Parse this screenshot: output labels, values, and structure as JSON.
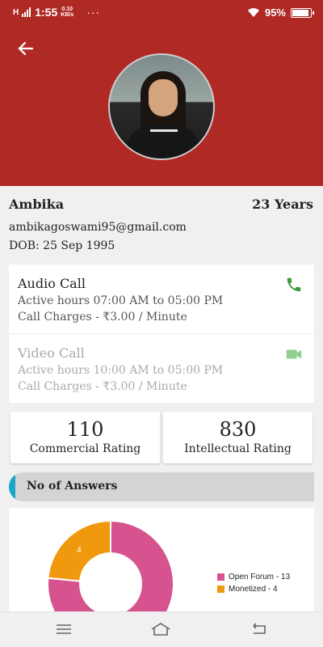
{
  "status_bar": {
    "network": "H",
    "time": "1:55",
    "speed_value": "0.10",
    "speed_unit": "KB/s",
    "dots": "···",
    "battery": "95%",
    "battery_level": 0.95
  },
  "profile": {
    "name": "Ambika",
    "age": "23 Years",
    "email": "ambikagoswami95@gmail.com",
    "dob": "DOB: 25 Sep 1995"
  },
  "calls": {
    "audio": {
      "title": "Audio Call",
      "hours": "Active hours 07:00 AM to 05:00 PM",
      "charges": "Call Charges - ₹3.00 / Minute",
      "enabled": true
    },
    "video": {
      "title": "Video Call",
      "hours": "Active hours 10:00 AM to 05:00 PM",
      "charges": "Call Charges - ₹3.00 / Minute",
      "enabled": false
    }
  },
  "ratings": {
    "commercial": {
      "value": "110",
      "label": "Commercial Rating"
    },
    "intellectual": {
      "value": "830",
      "label": "Intellectual Rating"
    }
  },
  "answers_section": {
    "title": "No of Answers"
  },
  "chart_data": {
    "type": "pie",
    "slices": [
      {
        "label": "Open Forum",
        "value": 13,
        "color": "#d6538f"
      },
      {
        "label": "Monetized",
        "value": 4,
        "color": "#f0990e"
      }
    ],
    "legend": [
      "Open Forum - 13",
      "Monetized - 4"
    ],
    "data_labels": [
      "4"
    ],
    "legend_position": "right"
  },
  "colors": {
    "header": "#b02a25",
    "call_green": "#3a9b3a",
    "video_green_disabled": "#8fd08f",
    "section_accent": "#1aa6c8"
  }
}
